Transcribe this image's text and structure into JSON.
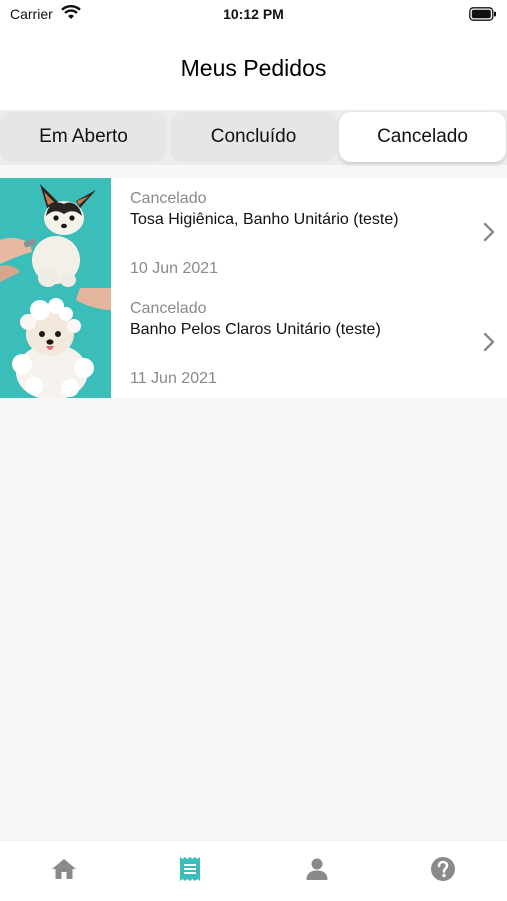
{
  "status_bar": {
    "carrier": "Carrier",
    "time": "10:12 PM"
  },
  "header": {
    "title": "Meus Pedidos"
  },
  "tabs": [
    {
      "label": "Em Aberto",
      "active": false
    },
    {
      "label": "Concluído",
      "active": false
    },
    {
      "label": "Cancelado",
      "active": true
    }
  ],
  "orders": [
    {
      "status": "Cancelado",
      "name": "Tosa Higiênica, Banho Unitário (teste)",
      "date": "10 Jun 2021",
      "image": "dog-grooming-photo"
    },
    {
      "status": "Cancelado",
      "name": "Banho Pelos Claros Unitário (teste)",
      "date": "11 Jun 2021",
      "image": "dog-bath-photo"
    }
  ],
  "tab_bar": {
    "items": [
      {
        "icon": "home-icon",
        "active": false
      },
      {
        "icon": "receipt-icon",
        "active": true
      },
      {
        "icon": "user-icon",
        "active": false
      },
      {
        "icon": "help-icon",
        "active": false
      }
    ]
  },
  "colors": {
    "accent": "#3bbdb9",
    "icon_inactive": "#8a8a8a",
    "secondary_text": "#8a8a8a"
  }
}
